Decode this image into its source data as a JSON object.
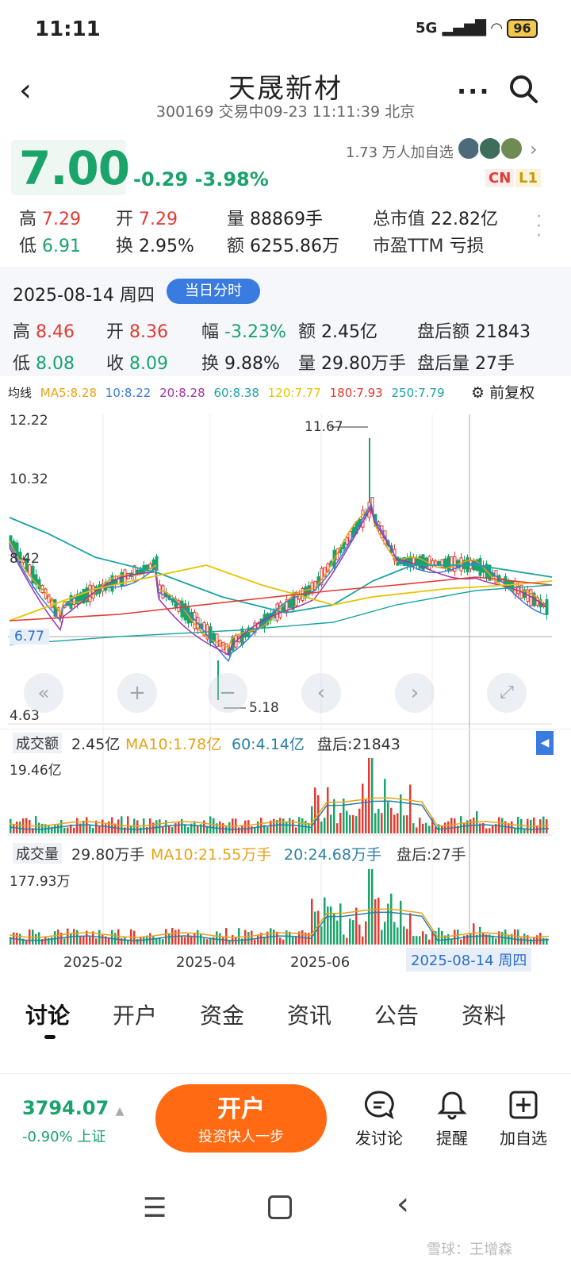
{
  "status": {
    "time": "11:11",
    "network": "5G",
    "battery": "96"
  },
  "header": {
    "title": "天晟新材",
    "subtitle": "300169 交易中09-23 11:11:39 北京"
  },
  "quote": {
    "price": "7.00",
    "change": "-0.29",
    "change_pct": "-3.98%",
    "followers": "1.73 万人加自选",
    "badge_cn": "CN",
    "badge_l1": "L1",
    "stats": [
      {
        "k": "高",
        "v": "7.29"
      },
      {
        "k": "开",
        "v": "7.29"
      },
      {
        "k": "量",
        "v": "88869手"
      },
      {
        "k": "总市值",
        "v": "22.82亿"
      },
      {
        "k": "低",
        "v": "6.91"
      },
      {
        "k": "换",
        "v": "2.95%"
      },
      {
        "k": "额",
        "v": "6255.86万"
      },
      {
        "k": "市盈TTM",
        "v": "亏损"
      }
    ]
  },
  "day": {
    "date": "2025-08-14 周四",
    "button": "当日分时",
    "stats": [
      {
        "k": "高",
        "v": "8.46"
      },
      {
        "k": "开",
        "v": "8.36"
      },
      {
        "k": "幅",
        "v": "-3.23%"
      },
      {
        "k": "额",
        "v": "2.45亿"
      },
      {
        "k": "盘后额",
        "v": "21843"
      },
      {
        "k": "低",
        "v": "8.08"
      },
      {
        "k": "收",
        "v": "8.09"
      },
      {
        "k": "换",
        "v": "9.88%"
      },
      {
        "k": "量",
        "v": "29.80万手"
      },
      {
        "k": "盘后量",
        "v": "27手"
      }
    ]
  },
  "ma": {
    "label": "均线",
    "items": [
      {
        "t": "MA5:8.28",
        "c": "#e8a317"
      },
      {
        "t": "10:8.22",
        "c": "#3a7be0"
      },
      {
        "t": "20:8.28",
        "c": "#a233a8"
      },
      {
        "t": "60:8.38",
        "c": "#1aa3a3"
      },
      {
        "t": "120:7.77",
        "c": "#e8c300"
      },
      {
        "t": "180:7.93",
        "c": "#e23b32"
      },
      {
        "t": "250:7.79",
        "c": "#1aa3a3"
      }
    ],
    "fq": "前复权"
  },
  "chart_data": [
    {
      "type": "candlestick",
      "yticks": [
        "12.22",
        "10.32",
        "8.42",
        "6.77",
        "4.63"
      ],
      "y_range": [
        4.63,
        12.22
      ],
      "current": "6.77",
      "max_label": "11.67",
      "min_label": "5.18",
      "xlabels": [
        "2025-02",
        "2025-04",
        "2025-06"
      ],
      "cursor_label": "2025-08-14 周四"
    },
    {
      "type": "bar",
      "title": "成交额",
      "value": "2.45亿",
      "ma10": "MA10:1.78亿",
      "ma60": "60:4.14亿",
      "after": "盘后:21843",
      "ymax": "19.46亿"
    },
    {
      "type": "bar",
      "title": "成交量",
      "value": "29.80万手",
      "ma10": "MA10:21.55万手",
      "ma20": "20:24.68万手",
      "after": "盘后:27手",
      "ymax": "177.93万"
    }
  ],
  "tabs": [
    "讨论",
    "开户",
    "资金",
    "资讯",
    "公告",
    "资料"
  ],
  "bottom": {
    "index_value": "3794.07",
    "index_sub": "-0.90% 上证",
    "open_main": "开户",
    "open_sub": "投资快人一步",
    "discuss": "发讨论",
    "remind": "提醒",
    "add": "加自选"
  },
  "watermark": "雪球：王增森",
  "colors": {
    "up": "#e23b32",
    "down": "#1aa36b",
    "accent": "#3a7be0",
    "orange": "#ff6a13"
  }
}
